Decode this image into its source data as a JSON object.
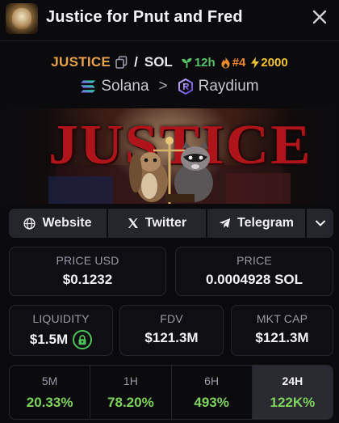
{
  "header": {
    "title": "Justice for Pnut and Fred"
  },
  "pair": {
    "base_symbol": "JUSTICE",
    "separator": "/",
    "quote_symbol": "SOL",
    "age": "12h",
    "rank": "#4",
    "boosts": "2000"
  },
  "chain": {
    "network": "Solana",
    "dex": "Raydium"
  },
  "banner": {
    "word": "JUSTICE"
  },
  "links": {
    "website": "Website",
    "twitter": "Twitter",
    "telegram": "Telegram"
  },
  "stats": {
    "price_usd": {
      "label": "PRICE USD",
      "value": "$0.1232"
    },
    "price_native": {
      "label": "PRICE",
      "value": "0.0004928 SOL"
    },
    "liquidity": {
      "label": "LIQUIDITY",
      "value": "$1.5M"
    },
    "fdv": {
      "label": "FDV",
      "value": "$121.3M"
    },
    "mcap": {
      "label": "MKT CAP",
      "value": "$121.3M"
    }
  },
  "changes": [
    {
      "label": "5M",
      "value": "20.33%"
    },
    {
      "label": "1H",
      "value": "78.20%"
    },
    {
      "label": "6H",
      "value": "493%"
    },
    {
      "label": "24H",
      "value": "122K%"
    }
  ],
  "colors": {
    "accent_orange": "#e9a24a",
    "positive_green": "#7ed35f",
    "age_green": "#58c26a",
    "rank_orange": "#f08b2d",
    "boost_yellow": "#f4c430",
    "lock_green": "#4ec35a"
  },
  "icons": {
    "close": "close-icon",
    "copy": "copy-icon",
    "age": "sprout-icon",
    "rank": "flame-icon",
    "boost": "lightning-icon",
    "network": "solana-icon",
    "dex": "raydium-icon",
    "website": "globe-icon",
    "twitter": "x-icon",
    "telegram": "telegram-icon",
    "more": "chevron-down-icon",
    "lock": "lock-icon"
  }
}
